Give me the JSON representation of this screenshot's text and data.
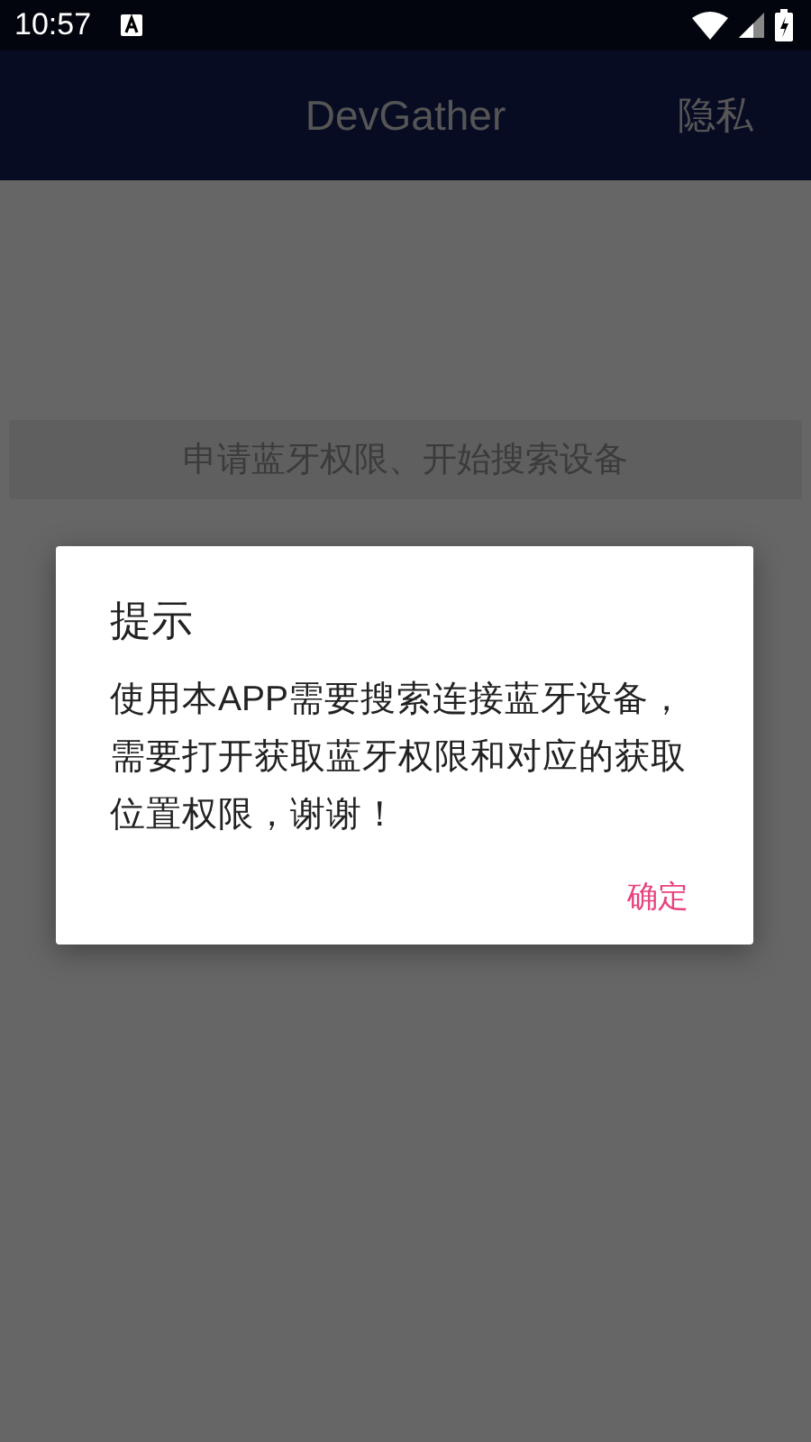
{
  "status_bar": {
    "time": "10:57"
  },
  "app_bar": {
    "title": "DevGather",
    "action": "隐私"
  },
  "main_button": {
    "label": "申请蓝牙权限、开始搜索设备"
  },
  "dialog": {
    "title": "提示",
    "message": "使用本APP需要搜索连接蓝牙设备，需要打开获取蓝牙权限和对应的获取位置权限，谢谢！",
    "buttons": [
      "确定"
    ]
  }
}
